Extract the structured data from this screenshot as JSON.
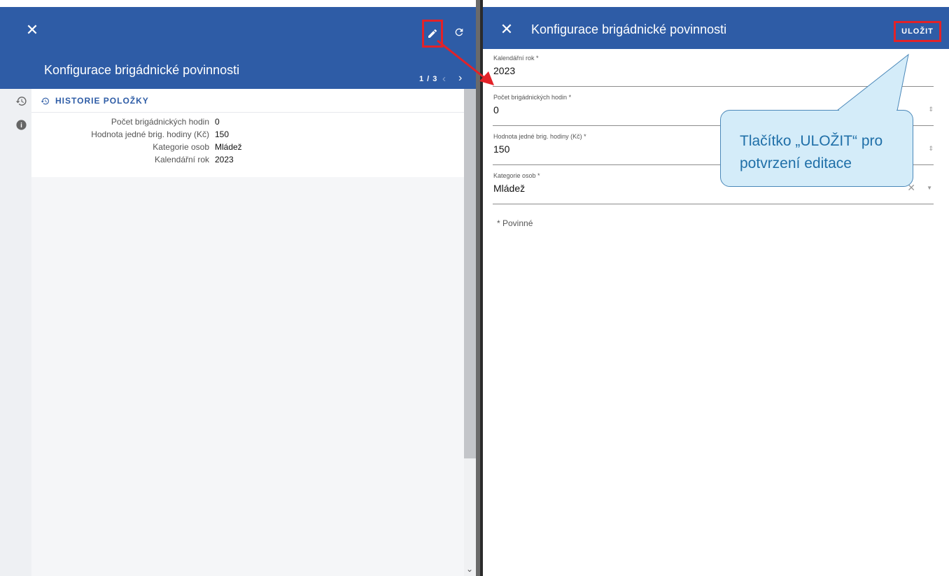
{
  "left": {
    "title": "Konfigurace brigádnické povinnosti",
    "pager": "1 / 3",
    "pager_prev": "‹",
    "pager_next": "›",
    "close": "✕",
    "history_heading": "HISTORIE POLOŽKY",
    "history_rows": [
      {
        "label": "Počet brigádnických hodin",
        "value": "0"
      },
      {
        "label": "Hodnota jedné brig. hodiny (Kč)",
        "value": "150"
      },
      {
        "label": "Kategorie osob",
        "value": "Mládež"
      },
      {
        "label": "Kalendářní rok",
        "value": "2023"
      }
    ]
  },
  "right": {
    "title": "Konfigurace brigádnické povinnosti",
    "close": "✕",
    "save_label": "ULOŽIT",
    "fields": [
      {
        "label": "Kalendářní rok *",
        "value": "2023"
      },
      {
        "label": "Počet brigádnických hodin *",
        "value": "0"
      },
      {
        "label": "Hodnota jedné brig. hodiny (Kč) *",
        "value": "150"
      },
      {
        "label": "Kategorie osob *",
        "value": "Mládež"
      }
    ],
    "required_note": "* Povinné"
  },
  "callout": {
    "text": "Tlačítko „ULOŽIT“ pro\npotvrzení editace"
  },
  "colors": {
    "header_blue": "#2e5ca6",
    "highlight_red": "#e32228",
    "callout_fill": "#d4ecf9",
    "callout_text": "#1f6fa8"
  }
}
